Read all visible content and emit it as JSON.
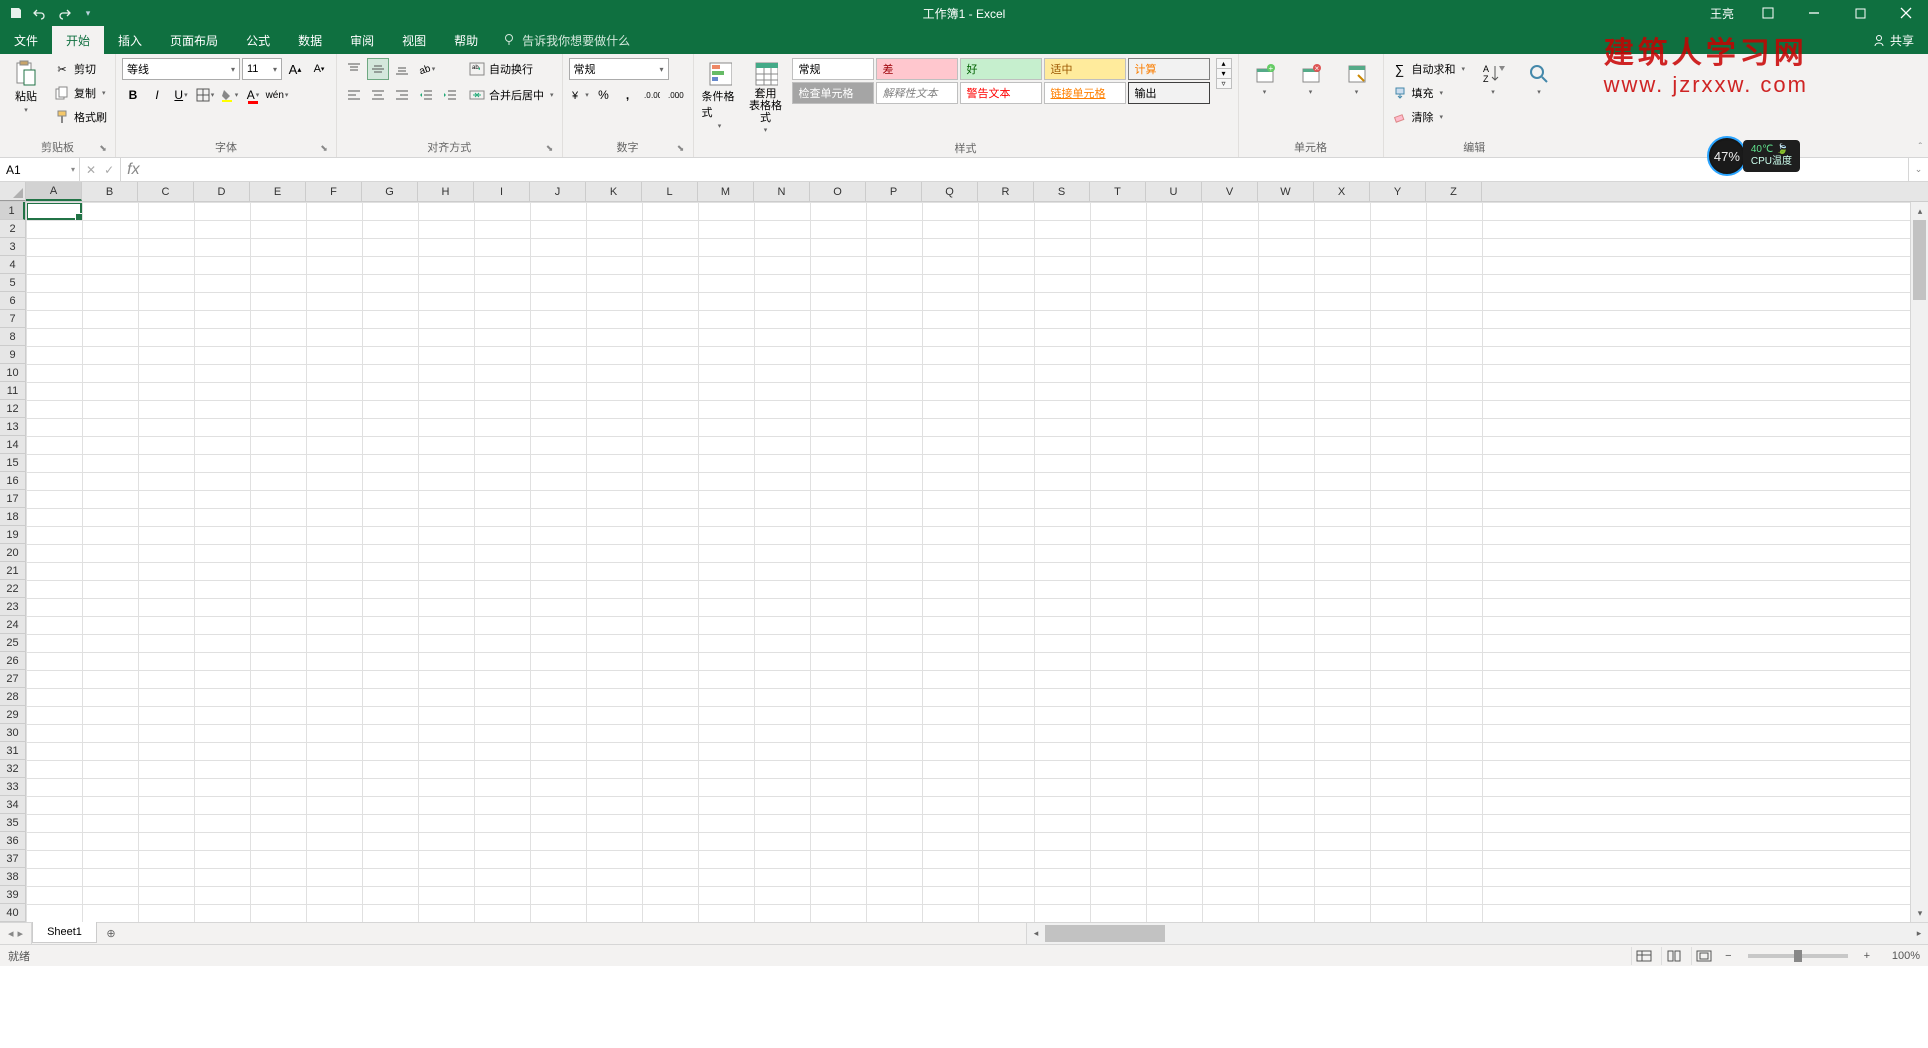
{
  "title": "工作簿1 - Excel",
  "user": "王亮",
  "share": "共享",
  "tabs": [
    "文件",
    "开始",
    "插入",
    "页面布局",
    "公式",
    "数据",
    "审阅",
    "视图",
    "帮助"
  ],
  "active_tab": 1,
  "tellme": "告诉我你想要做什么",
  "ribbon": {
    "clipboard": {
      "label": "剪贴板",
      "paste": "粘贴",
      "cut": "剪切",
      "copy": "复制",
      "painter": "格式刷"
    },
    "font": {
      "label": "字体",
      "name": "等线",
      "size": "11"
    },
    "align": {
      "label": "对齐方式",
      "wrap": "自动换行",
      "merge": "合并后居中"
    },
    "number": {
      "label": "数字",
      "format": "常规"
    },
    "styles_group": {
      "label": "样式",
      "cond": "条件格式",
      "table": "套用\n表格格式"
    },
    "styles": {
      "r1": [
        "常规",
        "差",
        "好",
        "适中",
        "计算"
      ],
      "r2": [
        "检查单元格",
        "解释性文本",
        "警告文本",
        "链接单元格",
        "输出"
      ]
    },
    "cells": {
      "label": "单元格"
    },
    "editing": {
      "label": "编辑",
      "autosum": "自动求和",
      "fill": "填充",
      "clear": "清除"
    }
  },
  "namebox": "A1",
  "columns": [
    "A",
    "B",
    "C",
    "D",
    "E",
    "F",
    "G",
    "H",
    "I",
    "J",
    "K",
    "L",
    "M",
    "N",
    "O",
    "P",
    "Q",
    "R",
    "S",
    "T",
    "U",
    "V",
    "W",
    "X",
    "Y",
    "Z"
  ],
  "rows": 40,
  "sheet": "Sheet1",
  "status": "就绪",
  "zoom": "100%",
  "watermark": {
    "l1": "建筑人学习网",
    "l2": "www. jzrxxw. com"
  },
  "cpu": {
    "pct": "47%",
    "temp": "40℃",
    "label": "CPU温度"
  }
}
